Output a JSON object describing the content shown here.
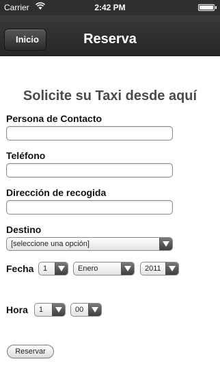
{
  "status_bar": {
    "carrier": "Carrier",
    "time": "2:42 PM",
    "wifi_icon": "wifi-icon",
    "battery_icon": "battery-icon"
  },
  "nav": {
    "back_label": "Inicio",
    "title": "Reserva"
  },
  "form": {
    "heading": "Solicite su Taxi desde aquí",
    "contact_label": "Persona de Contacto",
    "contact_value": "",
    "phone_label": "Teléfono",
    "phone_value": "",
    "pickup_label": "Dirección de recogida",
    "pickup_value": "",
    "destination_label": "Destino",
    "destination_selected": "[seleccione una opción]",
    "date_label": "Fecha",
    "date_day": "1",
    "date_month": "Enero",
    "date_year": "2011",
    "time_label": "Hora",
    "time_hour": "1",
    "time_minute": "00",
    "submit_label": "Reservar"
  }
}
